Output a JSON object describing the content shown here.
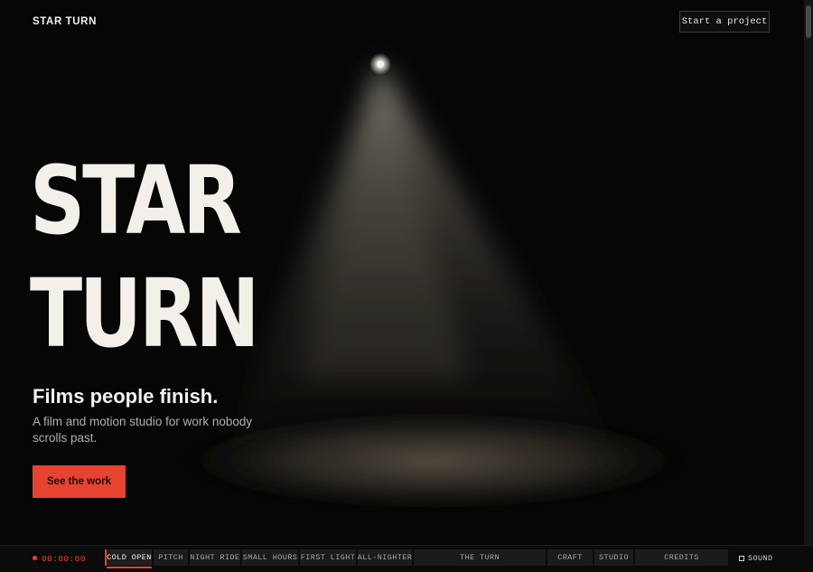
{
  "header": {
    "brand": "STAR TURN",
    "cta_label": "Start a project"
  },
  "hero": {
    "title_lines": [
      "STAR",
      "TURN"
    ],
    "tagline": "Films people finish.",
    "subtitle": "A film and motion studio for work nobody scrolls past.",
    "button_label": "See the work"
  },
  "timeline": {
    "timecode": "00:00:00",
    "segments": [
      {
        "label": "COLD OPEN",
        "active": true
      },
      {
        "label": "PITCH"
      },
      {
        "label": "NIGHT RIDE"
      },
      {
        "label": "SMALL HOURS"
      },
      {
        "label": "FIRST LIGHT"
      },
      {
        "label": "ALL-NIGHTER"
      },
      {
        "label": "THE TURN"
      },
      {
        "label": "CRAFT"
      },
      {
        "label": "STUDIO"
      },
      {
        "label": "CREDITS"
      }
    ],
    "sound_label": "SOUND"
  },
  "colors": {
    "accent": "#e64331",
    "background": "#060606",
    "text": "#f3f0ea"
  }
}
